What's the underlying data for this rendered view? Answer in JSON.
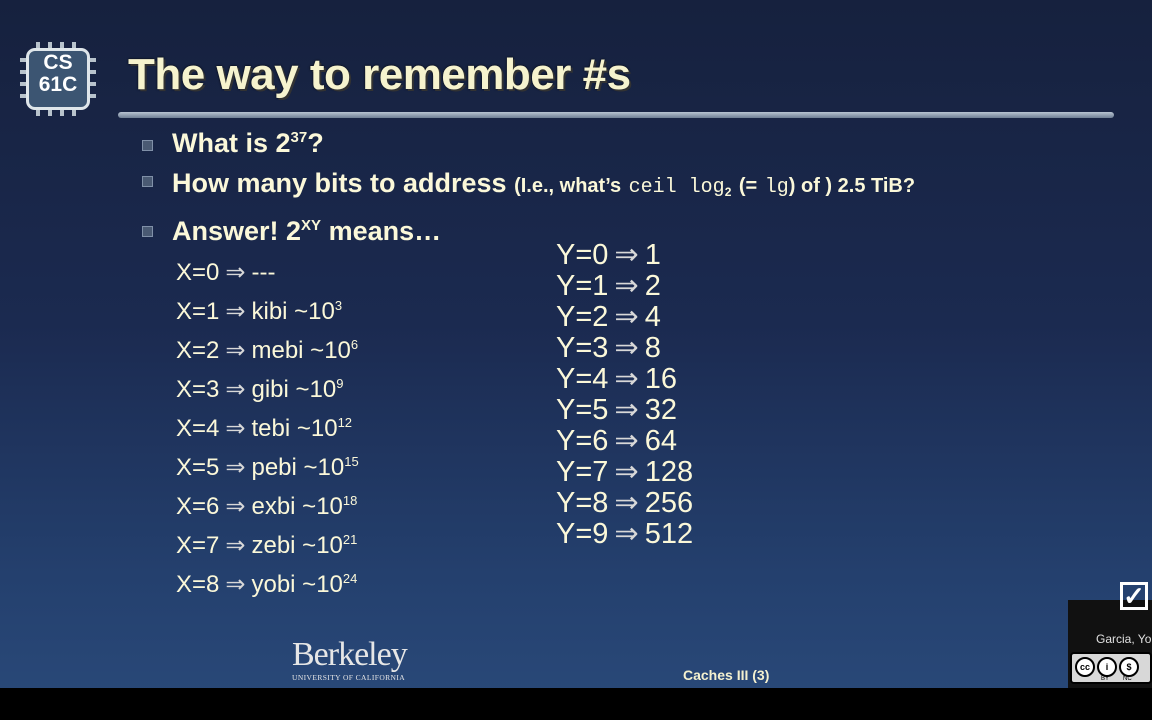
{
  "logo": {
    "line1": "CS",
    "line2": "61C"
  },
  "title": "The way to remember #s",
  "bullets": {
    "b1": {
      "text": "What is 2",
      "sup": "37",
      "tail": "?"
    },
    "b2": {
      "text": "How many bits to address",
      "paren_open": "(I.e., what’s",
      "code": "ceil log",
      "code_sub": "2",
      "middle": "(=",
      "code2": "lg",
      "close": ") of ) 2.5 TiB?"
    },
    "b3": {
      "text": "Answer! 2",
      "sup": "XY",
      "tail": " means…"
    }
  },
  "arrow": "⇒",
  "x_rows": [
    {
      "lhs": "X=0",
      "rhs": "---",
      "sup": ""
    },
    {
      "lhs": "X=1",
      "rhs": "kibi ~10",
      "sup": "3"
    },
    {
      "lhs": "X=2",
      "rhs": "mebi ~10",
      "sup": "6"
    },
    {
      "lhs": "X=3",
      "rhs": "gibi ~10",
      "sup": "9"
    },
    {
      "lhs": "X=4",
      "rhs": "tebi ~10",
      "sup": "12"
    },
    {
      "lhs": "X=5",
      "rhs": "pebi ~10",
      "sup": "15"
    },
    {
      "lhs": "X=6",
      "rhs": "exbi ~10",
      "sup": "18"
    },
    {
      "lhs": "X=7",
      "rhs": "zebi ~10",
      "sup": "21"
    },
    {
      "lhs": "X=8",
      "rhs": "yobi ~10",
      "sup": "24"
    }
  ],
  "y_rows": [
    {
      "lhs": "Y=0",
      "rhs": "1"
    },
    {
      "lhs": "Y=1",
      "rhs": "2"
    },
    {
      "lhs": "Y=2",
      "rhs": "4"
    },
    {
      "lhs": "Y=3",
      "rhs": "8"
    },
    {
      "lhs": "Y=4",
      "rhs": "16"
    },
    {
      "lhs": "Y=5",
      "rhs": "32"
    },
    {
      "lhs": "Y=6",
      "rhs": "64"
    },
    {
      "lhs": "Y=7",
      "rhs": "128"
    },
    {
      "lhs": "Y=8",
      "rhs": "256"
    },
    {
      "lhs": "Y=9",
      "rhs": "512"
    }
  ],
  "footer": {
    "berkeley": "Berkeley",
    "university": "UNIVERSITY OF CALIFORNIA",
    "center": "Caches III (3)",
    "author": "Garcia, Yo",
    "cc_labels": [
      "BY",
      "NC"
    ]
  },
  "colors": {
    "title": "#f6f3ce",
    "text": "#fbf8d9",
    "background": "#1b2a50"
  }
}
